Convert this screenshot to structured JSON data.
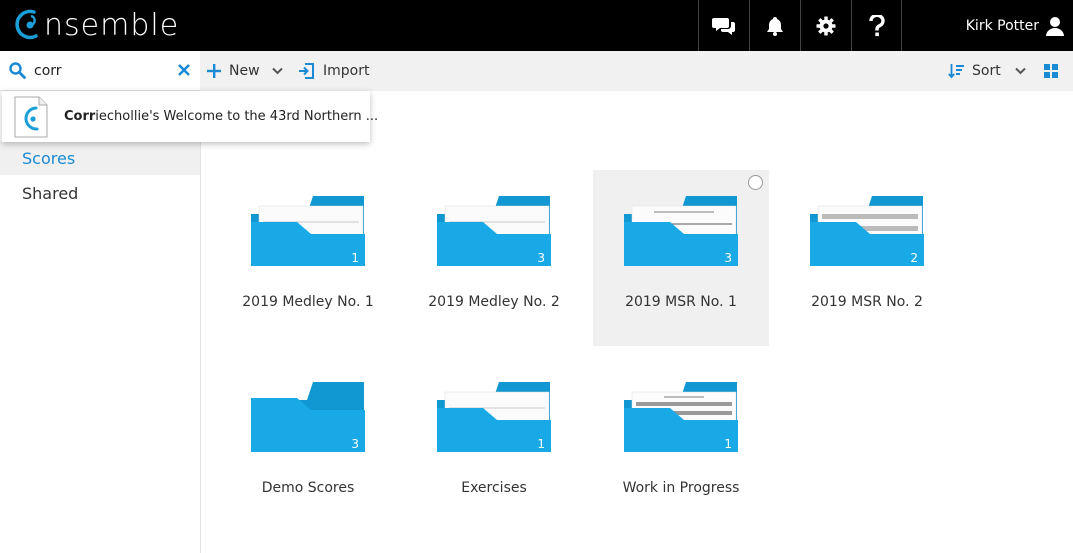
{
  "app": {
    "logo_text": "nsemble",
    "user_name": "Kirk Potter"
  },
  "colors": {
    "accent": "#1a8ad4",
    "folder_blue": "#19a9e6",
    "folder_tab": "#1197d1"
  },
  "topbar": {
    "icons": [
      "chat-icon",
      "bell-icon",
      "gear-icon",
      "help-icon",
      "user-icon"
    ]
  },
  "search": {
    "value": "corr",
    "placeholder": ""
  },
  "toolbar": {
    "new_label": "New",
    "import_label": "Import",
    "sort_label": "Sort"
  },
  "search_result": {
    "match": "Corr",
    "rest": "iechollie's Welcome to the 43rd Northern ..."
  },
  "sidebar": {
    "items": [
      {
        "label": "Scores"
      },
      {
        "label": "Shared"
      }
    ]
  },
  "folders": [
    {
      "name": "2019 Medley No. 1",
      "count": "1"
    },
    {
      "name": "2019 Medley No. 2",
      "count": "3"
    },
    {
      "name": "2019 MSR No. 1",
      "count": "3"
    },
    {
      "name": "2019 MSR No. 2",
      "count": "2"
    },
    {
      "name": "Demo Scores",
      "count": "3"
    },
    {
      "name": "Exercises",
      "count": "1"
    },
    {
      "name": "Work in Progress",
      "count": "1"
    }
  ]
}
